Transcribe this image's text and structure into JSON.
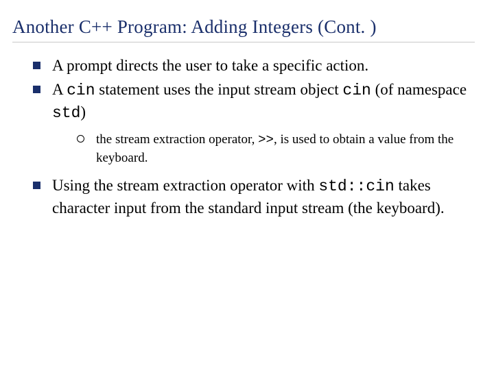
{
  "title": "Another C++ Program: Adding Integers (Cont. )",
  "bullets": {
    "b1": {
      "t1": "A ",
      "t2": "prompt",
      "t3": " directs the user to take a specific action."
    },
    "b2": {
      "t1": "A ",
      "c1": "cin",
      "t2": " statement uses the ",
      "t3": "input stream object",
      "t4": " ",
      "c2": "cin",
      "t5": " (of namespace ",
      "c3": "std",
      "t6": ")"
    },
    "sub1": {
      "t1": "the ",
      "t2": "stream extraction operator",
      "t3": ", ",
      "c1": ">>",
      "t4": ", is used to obtain a value from the keyboard."
    },
    "b3": {
      "t1": "Using the stream extraction operator with ",
      "c1": "std::cin",
      "t2": " takes character input from the ",
      "t3": "standard input stream",
      "t4": " (the keyboard)."
    }
  }
}
